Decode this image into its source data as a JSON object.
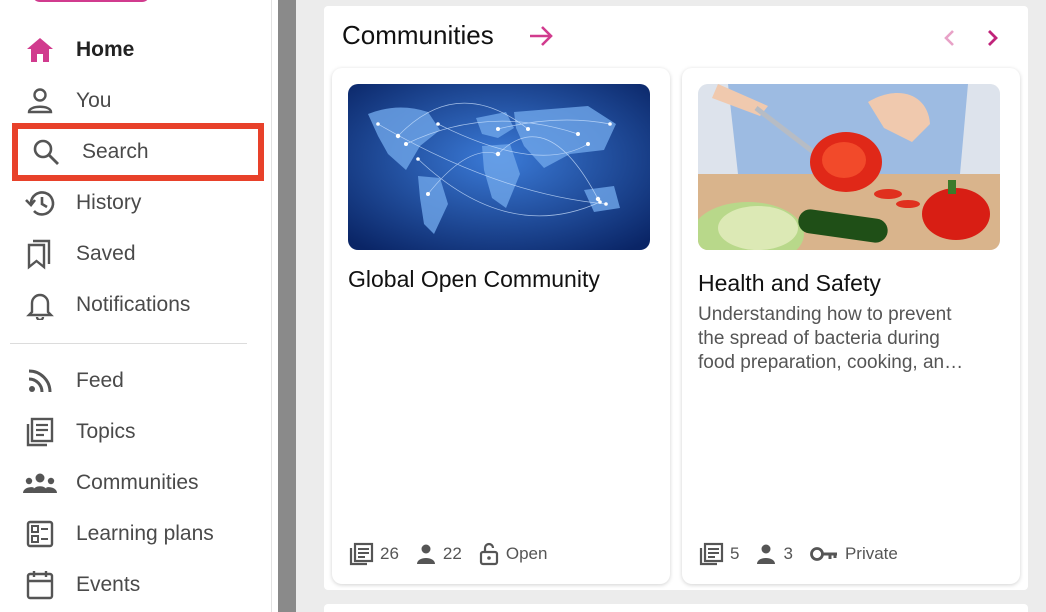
{
  "sidebar": {
    "items": [
      {
        "label": "Home",
        "icon": "home-icon"
      },
      {
        "label": "You",
        "icon": "person-icon"
      },
      {
        "label": "Search",
        "icon": "search-icon"
      },
      {
        "label": "History",
        "icon": "history-icon"
      },
      {
        "label": "Saved",
        "icon": "bookmark-icon"
      },
      {
        "label": "Notifications",
        "icon": "bell-icon"
      },
      {
        "label": "Feed",
        "icon": "rss-icon"
      },
      {
        "label": "Topics",
        "icon": "topics-icon"
      },
      {
        "label": "Communities",
        "icon": "groups-icon"
      },
      {
        "label": "Learning plans",
        "icon": "learning-plans-icon"
      },
      {
        "label": "Events",
        "icon": "calendar-icon"
      }
    ]
  },
  "communities": {
    "title": "Communities",
    "cards": [
      {
        "title": "Global Open Community",
        "description_lines": [],
        "posts": "26",
        "members": "22",
        "access": "Open"
      },
      {
        "title": "Health and Safety",
        "description_lines": [
          "Understanding how to prevent",
          "the spread of bacteria during",
          "food preparation, cooking, an…"
        ],
        "posts": "5",
        "members": "3",
        "access": "Private"
      }
    ]
  },
  "colors": {
    "accent": "#d13b8e",
    "highlight_box": "#e8412a",
    "separator": "#8a8a8a"
  }
}
